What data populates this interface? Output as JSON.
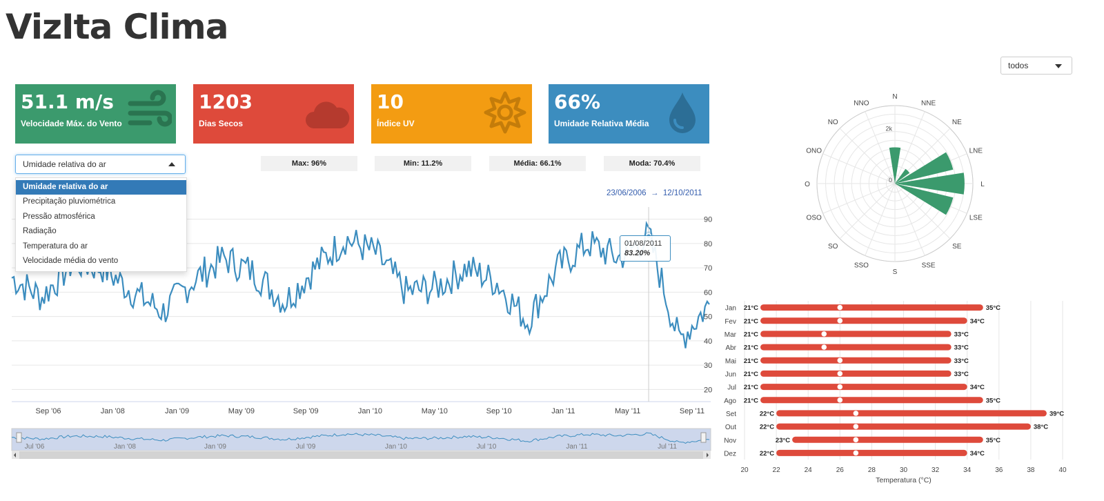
{
  "app": {
    "title": "VizIta Clima"
  },
  "station_select": {
    "value": "todos"
  },
  "kpis": [
    {
      "value": "51.1 m/s",
      "label": "Velocidade Máx. do Vento",
      "color": "#3b9a6d",
      "icon": "wind-icon"
    },
    {
      "value": "1203",
      "label": "Dias Secos",
      "color": "#de4a3b",
      "icon": "cloud-icon"
    },
    {
      "value": "10",
      "label": "Índice UV",
      "color": "#f39c12",
      "icon": "sun-icon"
    },
    {
      "value": "66%",
      "label": "Umidade Relativa Média",
      "color": "#3c8dbf",
      "icon": "drop-icon"
    }
  ],
  "stats": {
    "max": "Max: 96%",
    "min": "Min: 11.2%",
    "mean": "Média: 66.1%",
    "mode": "Moda: 70.4%"
  },
  "variable_select": {
    "value": "Umidade relativa do ar",
    "options": [
      "Umidade relativa do ar",
      "Precipitação pluviométrica",
      "Pressão atmosférica",
      "Radiação",
      "Temperatura do ar",
      "Velocidade média do vento"
    ]
  },
  "range": {
    "start": "23/06/2006",
    "arrow": "→",
    "end": "12/10/2011"
  },
  "tooltip": {
    "date": "01/08/2011",
    "value": "83.20%"
  },
  "chart_data": [
    {
      "type": "line",
      "series": [
        {
          "name": "Umidade relativa do ar",
          "x": [
            "2006-06",
            "2006-09",
            "2006-12",
            "2007-03",
            "2007-06",
            "2007-09",
            "2007-12",
            "2008-03",
            "2008-06",
            "2008-09",
            "2008-12",
            "2009-03",
            "2009-06",
            "2009-09",
            "2009-12",
            "2010-03",
            "2010-06",
            "2010-09",
            "2010-12",
            "2011-03",
            "2011-06",
            "2011-08",
            "2011-09",
            "2011-10"
          ],
          "values": [
            66,
            58,
            72,
            70,
            60,
            52,
            65,
            74,
            68,
            56,
            70,
            82,
            76,
            60,
            62,
            70,
            64,
            48,
            70,
            80,
            74,
            83,
            40,
            55
          ]
        }
      ],
      "x_ticks": [
        "Sep '06",
        "Jan '08",
        "Jan '09",
        "May '09",
        "Sep '09",
        "Jan '10",
        "May '10",
        "Sep '10",
        "Jan '11",
        "May '11",
        "Sep '11"
      ],
      "y_ticks": [
        20,
        30,
        40,
        50,
        60,
        70,
        80,
        90
      ],
      "navigator_ticks": [
        "Jul '06",
        "Jan '08",
        "Jan '09",
        "Jul '09",
        "Jan '10",
        "Jul '10",
        "Jan '11",
        "Jul '11"
      ],
      "ylim": [
        15,
        95
      ]
    },
    {
      "type": "bar",
      "subtype": "polar-windrose",
      "categories": [
        "N",
        "NNE",
        "NE",
        "LNE",
        "L",
        "LSE",
        "SE",
        "SSE",
        "S",
        "SSO",
        "SO",
        "OSO",
        "O",
        "ONO",
        "NO",
        "NNO"
      ],
      "values": [
        1300,
        0,
        650,
        2150,
        2500,
        2150,
        0,
        0,
        0,
        0,
        0,
        0,
        0,
        0,
        0,
        0
      ],
      "radial_ticks": [
        "0",
        "2k"
      ]
    },
    {
      "type": "bar",
      "subtype": "range",
      "categories": [
        "Jan",
        "Fev",
        "Mar",
        "Abr",
        "Mai",
        "Jun",
        "Jul",
        "Ago",
        "Set",
        "Out",
        "Nov",
        "Dez"
      ],
      "series": [
        {
          "low": [
            21,
            21,
            21,
            21,
            21,
            21,
            21,
            21,
            22,
            22,
            23,
            22
          ],
          "high": [
            35,
            34,
            33,
            33,
            33,
            33,
            34,
            35,
            39,
            38,
            35,
            34
          ],
          "mean": [
            26,
            26,
            25,
            25,
            26,
            26,
            26,
            26,
            27,
            27,
            27,
            27
          ],
          "low_labels": [
            "21°C",
            "21°C",
            "21°C",
            "21°C",
            "21°C",
            "21°C",
            "21°C",
            "21°C",
            "22°C",
            "22°C",
            "23°C",
            "22°C"
          ],
          "high_labels": [
            "35°C",
            "34°C",
            "33°C",
            "33°C",
            "33°C",
            "33°C",
            "34°C",
            "35°C",
            "39°C",
            "38°C",
            "35°C",
            "34°C"
          ]
        }
      ],
      "x_ticks": [
        20,
        22,
        24,
        26,
        28,
        30,
        32,
        34,
        36,
        38,
        40
      ],
      "xlabel": "Temperatura (°C)",
      "xlim": [
        20,
        40
      ],
      "color": "#de4a3b"
    }
  ]
}
